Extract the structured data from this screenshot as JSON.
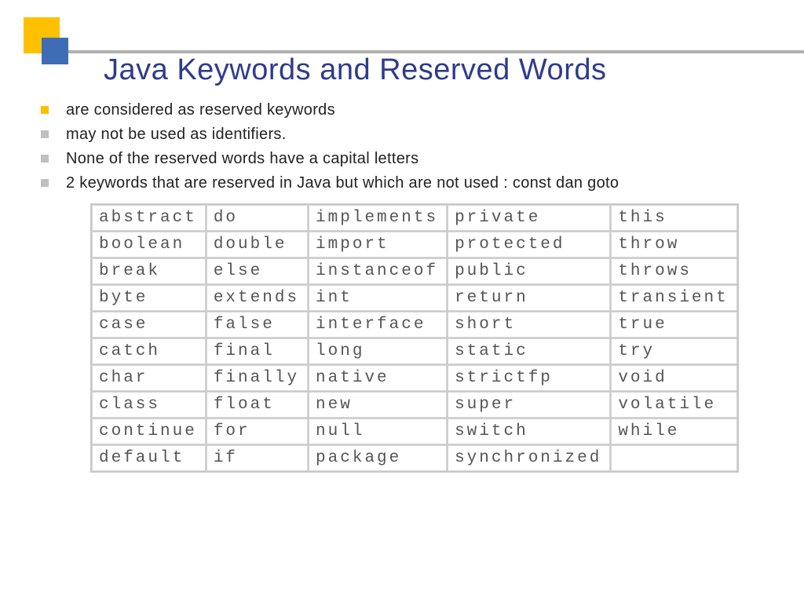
{
  "title": "Java Keywords and Reserved Words",
  "bullets": [
    "are considered as reserved keywords",
    "may not be used as identifiers.",
    "None of the reserved words have a capital letters",
    "2 keywords that are reserved in Java but which are not used : const dan goto"
  ],
  "table": {
    "rows": [
      [
        "abstract",
        "do",
        "implements",
        "private",
        "this"
      ],
      [
        "boolean",
        "double",
        "import",
        "protected",
        "throw"
      ],
      [
        "break",
        "else",
        "instanceof",
        "public",
        "throws"
      ],
      [
        "byte",
        "extends",
        "int",
        "return",
        "transient"
      ],
      [
        "case",
        "false",
        "interface",
        "short",
        "true"
      ],
      [
        "catch",
        "final",
        "long",
        "static",
        "try"
      ],
      [
        "char",
        "finally",
        "native",
        "strictfp",
        "void"
      ],
      [
        "class",
        "float",
        "new",
        "super",
        "volatile"
      ],
      [
        "continue",
        "for",
        "null",
        "switch",
        "while"
      ],
      [
        "default",
        "if",
        "package",
        "synchronized",
        ""
      ]
    ]
  }
}
